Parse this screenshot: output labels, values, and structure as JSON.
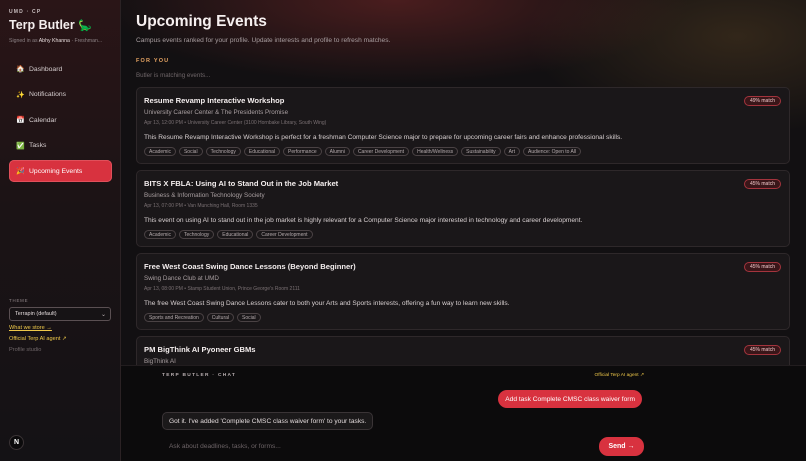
{
  "sidebar": {
    "kicker": "UMD · CP",
    "title": "Terp Butler",
    "title_emoji": "🦕",
    "signed_prefix": "Signed in as",
    "user_name": "Abhy Khanna",
    "user_role": "· Freshman...",
    "nav": [
      {
        "icon": "🏠",
        "icon_name": "home-icon",
        "label": "Dashboard",
        "active": false
      },
      {
        "icon": "✨",
        "icon_name": "sparkles-icon",
        "label": "Notifications",
        "active": false
      },
      {
        "icon": "📅",
        "icon_name": "calendar-icon",
        "label": "Calendar",
        "active": false
      },
      {
        "icon": "✅",
        "icon_name": "check-icon",
        "label": "Tasks",
        "active": false
      },
      {
        "icon": "🎉",
        "icon_name": "party-icon",
        "label": "Upcoming Events",
        "active": true
      }
    ],
    "theme_label": "THEME",
    "theme_value": "Terrapin (default)",
    "what_we_store": "What we store →",
    "official_agent": "Official Terp AI agent ↗",
    "profile_studio": "Profile studio",
    "logo_letter": "N"
  },
  "main": {
    "title": "Upcoming Events",
    "subtitle": "Campus events ranked for your profile. Update interests and profile to refresh matches.",
    "section_label": "FOR YOU",
    "status": "Butler is matching events...",
    "events": [
      {
        "title": "Resume Revamp Interactive Workshop",
        "org": "University Career Center & The Presidents Promise",
        "meta": "Apr 13, 12:00 PM • University Career Center (3100 Hornbake Library, South Wing)",
        "desc": "This Resume Revamp Interactive Workshop is perfect for a freshman Computer Science major to prepare for upcoming career fairs and enhance professional skills.",
        "match": "49% match",
        "tags": [
          "Academic",
          "Social",
          "Technology",
          "Educational",
          "Performance",
          "Alumni",
          "Career Development",
          "Health/Wellness",
          "Sustainability",
          "Art",
          "Audience: Open to All"
        ]
      },
      {
        "title": "BITS X FBLA: Using AI to Stand Out in the Job Market",
        "org": "Business & Information Technology Society",
        "meta": "Apr 13, 07:00 PM • Van Munching Hall, Room 1335",
        "desc": "This event on using AI to stand out in the job market is highly relevant for a Computer Science major interested in technology and career development.",
        "match": "45% match",
        "tags": [
          "Academic",
          "Technology",
          "Educational",
          "Career Development"
        ]
      },
      {
        "title": "Free West Coast Swing Dance Lessons (Beyond Beginner)",
        "org": "Swing Dance Club at UMD",
        "meta": "Apr 13, 08:00 PM • Stamp Student Union, Prince George's Room 2111",
        "desc": "The free West Coast Swing Dance Lessons cater to both your Arts and Sports interests, offering a fun way to learn new skills.",
        "match": "45% match",
        "tags": [
          "Sports and Recreation",
          "Cultural",
          "Social"
        ]
      },
      {
        "title": "PM BigThink AI Pyoneer GBMs",
        "org": "BigThink AI",
        "meta": "",
        "desc": "",
        "match": "45% match",
        "tags": []
      }
    ]
  },
  "chat": {
    "kicker": "TERP BUTLER · CHAT",
    "agent_link": "Official Terp AI agent ↗",
    "user_message": "Add task Complete CMSC class waiver form",
    "bot_message": "Got it. I've added 'Complete CMSC class waiver form' to your tasks.",
    "input_placeholder": "Ask about deadlines, tasks, or forms...",
    "input_value": "",
    "send_label": "Send →"
  },
  "colors": {
    "accent": "#d8323f",
    "link": "#f0c94a",
    "section_label": "#e6a463",
    "background": "#121012"
  }
}
